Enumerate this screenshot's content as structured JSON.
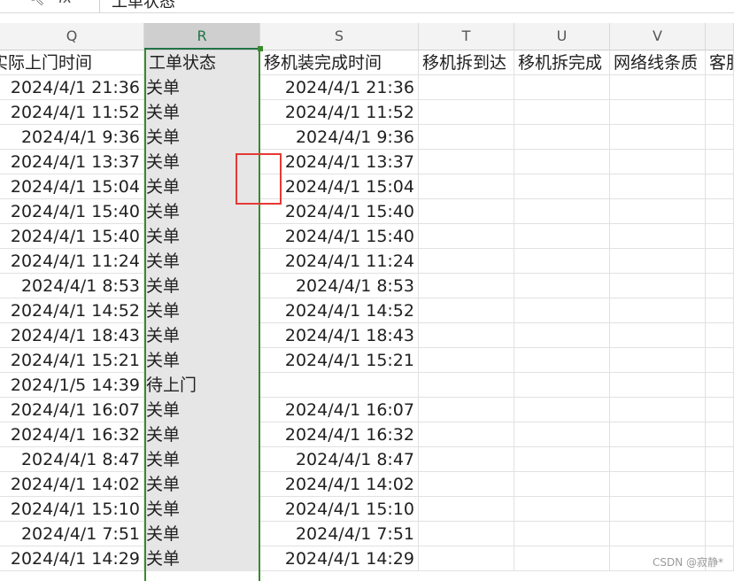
{
  "formula_bar": {
    "zoom_icon": "zoom-icon",
    "fx_label": "fx",
    "content": "工单状态"
  },
  "columns": [
    "Q",
    "R",
    "S",
    "T",
    "U",
    "V"
  ],
  "selected_column": "R",
  "header_row": {
    "q": "实际上门时间",
    "r": "工单状态",
    "s": "移机装完成时间",
    "t": "移机拆到达",
    "u": "移机拆完成",
    "v": "网络线条质",
    "w": "客服"
  },
  "rows": [
    {
      "q": "2024/4/1 21:36",
      "r": "关单",
      "s": "2024/4/1 21:36"
    },
    {
      "q": "2024/4/1 11:52",
      "r": "关单",
      "s": "2024/4/1 11:52"
    },
    {
      "q": "2024/4/1 9:36",
      "r": "关单",
      "s": "2024/4/1 9:36"
    },
    {
      "q": "2024/4/1 13:37",
      "r": "关单",
      "s": "2024/4/1 13:37"
    },
    {
      "q": "2024/4/1 15:04",
      "r": "关单",
      "s": "2024/4/1 15:04"
    },
    {
      "q": "2024/4/1 15:40",
      "r": "关单",
      "s": "2024/4/1 15:40"
    },
    {
      "q": "2024/4/1 15:40",
      "r": "关单",
      "s": "2024/4/1 15:40"
    },
    {
      "q": "2024/4/1 11:24",
      "r": "关单",
      "s": "2024/4/1 11:24"
    },
    {
      "q": "2024/4/1 8:53",
      "r": "关单",
      "s": "2024/4/1 8:53"
    },
    {
      "q": "2024/4/1 14:52",
      "r": "关单",
      "s": "2024/4/1 14:52"
    },
    {
      "q": "2024/4/1 18:43",
      "r": "关单",
      "s": "2024/4/1 18:43"
    },
    {
      "q": "2024/4/1 15:21",
      "r": "关单",
      "s": "2024/4/1 15:21"
    },
    {
      "q": "2024/1/5 14:39",
      "r": "待上门",
      "s": ""
    },
    {
      "q": "2024/4/1 16:07",
      "r": "关单",
      "s": "2024/4/1 16:07"
    },
    {
      "q": "2024/4/1 16:32",
      "r": "关单",
      "s": "2024/4/1 16:32"
    },
    {
      "q": "2024/4/1 8:47",
      "r": "关单",
      "s": "2024/4/1 8:47"
    },
    {
      "q": "2024/4/1 14:02",
      "r": "关单",
      "s": "2024/4/1 14:02"
    },
    {
      "q": "2024/4/1 15:10",
      "r": "关单",
      "s": "2024/4/1 15:10"
    },
    {
      "q": "2024/4/1 7:51",
      "r": "关单",
      "s": "2024/4/1 7:51"
    },
    {
      "q": "2024/4/1 14:29",
      "r": "关单",
      "s": "2024/4/1 14:29"
    }
  ],
  "watermark": "CSDN @寂静*",
  "colors": {
    "selection": "#3a8a2e",
    "selected_fill": "#e6e6e6",
    "highlight_box": "#e53935",
    "header_bg": "#f3f3f3"
  }
}
